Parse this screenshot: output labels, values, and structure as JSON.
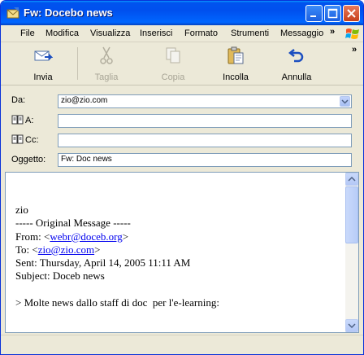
{
  "window": {
    "title": "Fw: Docebo news"
  },
  "menu": {
    "items": [
      "File",
      "Modifica",
      "Visualizza",
      "Inserisci",
      "Formato",
      "Strumenti",
      "Messaggio"
    ],
    "overflow": "»"
  },
  "toolbar": {
    "send_label": "Invia",
    "cut_label": "Taglia",
    "copy_label": "Copia",
    "paste_label": "Incolla",
    "undo_label": "Annulla",
    "overflow": "»"
  },
  "header": {
    "from_label": "Da:",
    "from_value": "zio@zio.com",
    "to_label": "A:",
    "to_value": "",
    "cc_label": "Cc:",
    "cc_value": "",
    "subject_label": "Oggetto:",
    "subject_value": "Fw: Doc  news"
  },
  "message": {
    "line_greeting": "zio",
    "line_separator": "----- Original Message -----",
    "from_prefix": "From: <",
    "from_email": "webr@doceb.org",
    "from_suffix": ">",
    "to_prefix": "To: <",
    "to_email": "zio@zio.com",
    "to_suffix": ">",
    "sent_line": "Sent: Thursday, April 14, 2005 11:11 AM",
    "subject_line": "Subject: Doceb news",
    "quote_line": "> Molte news dallo staff di doc  per l'e-learning:"
  },
  "colors": {
    "titlebar": "#0053ee",
    "chrome": "#ece9d8",
    "link": "#0000ee"
  }
}
